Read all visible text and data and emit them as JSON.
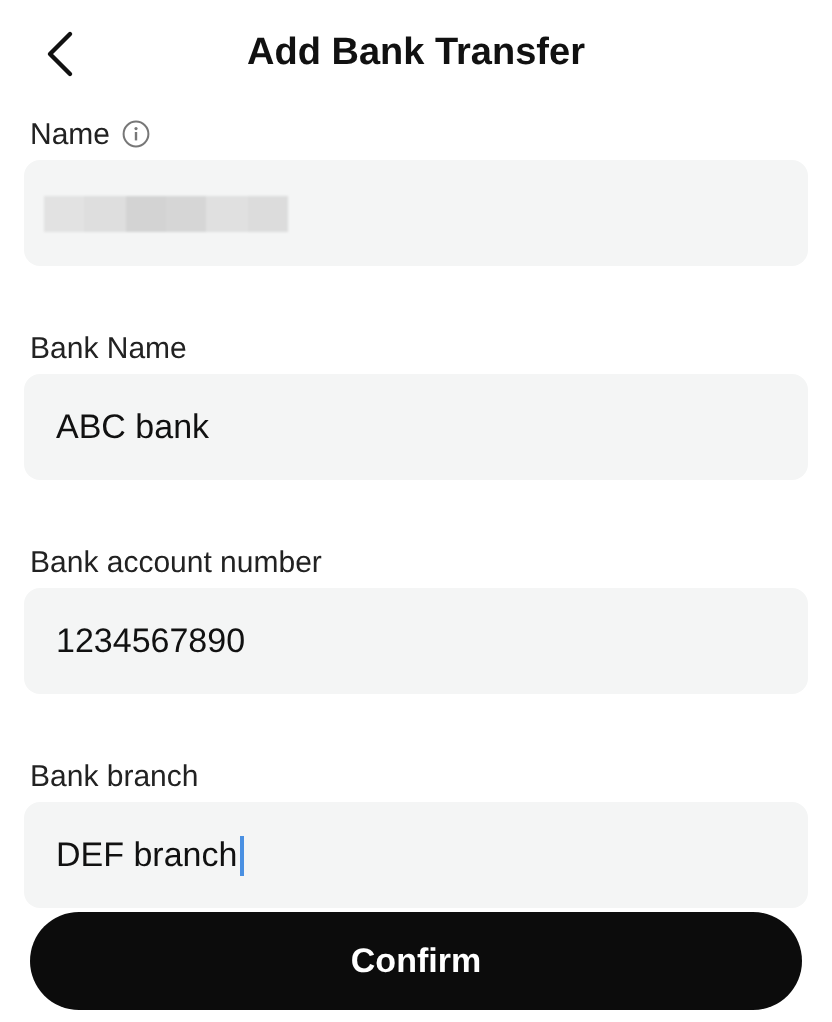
{
  "header": {
    "title": "Add Bank Transfer"
  },
  "fields": [
    {
      "label": "Name",
      "info": true,
      "kind": "redacted",
      "focused": false
    },
    {
      "label": "Bank Name",
      "info": false,
      "kind": "text",
      "value": "ABC bank",
      "focused": false
    },
    {
      "label": "Bank account number",
      "info": false,
      "kind": "text",
      "value": "1234567890",
      "focused": false
    },
    {
      "label": "Bank branch",
      "info": false,
      "kind": "text",
      "value": "DEF branch",
      "focused": true
    }
  ],
  "confirm_button": "Confirm"
}
